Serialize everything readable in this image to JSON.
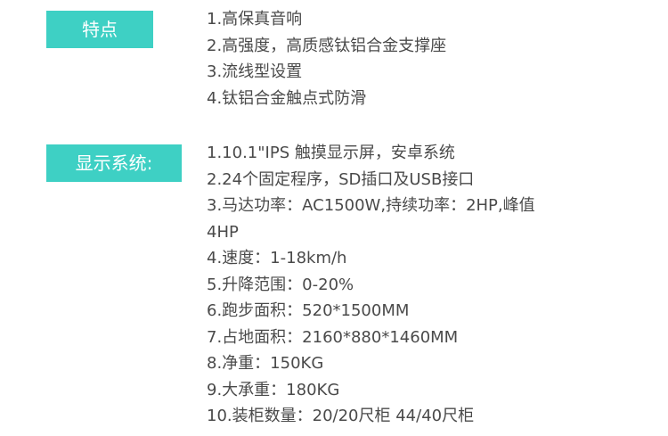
{
  "section1": {
    "tag": "特点",
    "items": [
      "1.高保真音响",
      "2.高强度，高质感钛铝合金支撑座",
      "3.流线型设置",
      "4.钛铝合金触点式防滑"
    ]
  },
  "section2": {
    "tag": "显示系统:",
    "items": [
      "1.10.1\"IPS 触摸显示屏，安卓系统",
      "2.24个固定程序，SD插口及USB接口",
      "3.马达功率：AC1500W,持续功率：2HP,峰值",
      "4HP",
      "4.速度：1-18km/h",
      "5.升降范围：0-20%",
      "6.跑步面积：520*1500MM",
      "7.占地面积：2160*880*1460MM",
      "8.净重：150KG",
      "9.大承重：180KG",
      "10.装柜数量：20/20尺柜  44/40尺柜"
    ]
  },
  "colors": {
    "tag_background": "#3ed0c4",
    "tag_text": "#ffffff",
    "body_text": "#4a4a4a"
  }
}
